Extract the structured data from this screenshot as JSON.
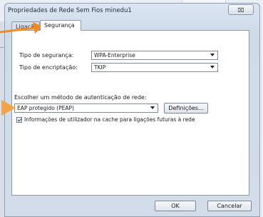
{
  "window": {
    "title": "Propriedades de Rede Sem Fios minedu1",
    "close_glyph": "⌧"
  },
  "tabs": [
    {
      "label": "Ligação"
    },
    {
      "label": "Segurança"
    }
  ],
  "security": {
    "security_type_label": "Tipo de segurança:",
    "security_type_value": "WPA-Enterprise",
    "encryption_type_label": "Tipo de encriptação:",
    "encryption_type_value": "TKIP",
    "auth_method_label": "Escolher um método de autenticação de rede:",
    "auth_method_value": "EAP protegido (PEAP)",
    "settings_button": "Definições...",
    "cache_checkbox_label": "Informações de utilizador na cache para ligações futuras à rede",
    "cache_checked": true
  },
  "footer": {
    "ok_button": "OK",
    "cancel_button": "Cancelar"
  },
  "annotation": {
    "arrow_color": "#f08a24",
    "icons": [
      "arrow-right-icon",
      "arrow-right-icon"
    ]
  }
}
